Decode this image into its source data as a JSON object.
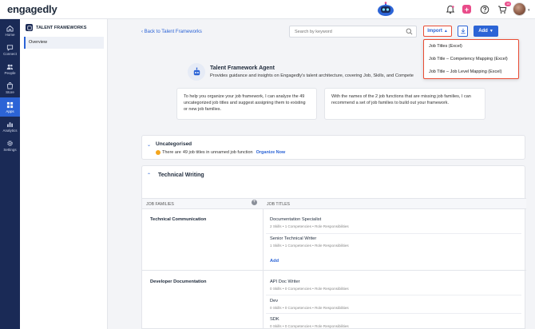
{
  "header": {
    "logo": "engagedly",
    "badge_count": "16",
    "add_label": "+",
    "icons": [
      "bell-icon",
      "plus-square-icon",
      "help-icon",
      "cart-icon"
    ]
  },
  "rail": {
    "items": [
      {
        "label": "Home",
        "icon": "home-icon"
      },
      {
        "label": "Connect",
        "icon": "chat-icon"
      },
      {
        "label": "People",
        "icon": "people-icon"
      },
      {
        "label": "Store",
        "icon": "store-icon"
      },
      {
        "label": "Apps",
        "icon": "apps-icon",
        "active": true
      },
      {
        "label": "Analytics",
        "icon": "analytics-icon"
      },
      {
        "label": "Settings",
        "icon": "settings-icon"
      }
    ]
  },
  "subnav": {
    "title": "TALENT FRAMEWORKS",
    "items": [
      "Overview"
    ]
  },
  "toolbar": {
    "back_label": "Back to Talent Frameworks",
    "search_placeholder": "Search by keyword",
    "import_label": "Import",
    "add_label": "Add"
  },
  "import_menu": {
    "options": [
      "Job Titles (Excel)",
      "Job Title – Competency Mapping (Excel)",
      "Job Title – Job Level Mapping (Excel)"
    ]
  },
  "agent": {
    "title": "Talent Framework Agent",
    "subtitle": "Provides guidance and insights on Engagedly's talent architecture, covering Job, Skills, and Compete",
    "cards": [
      "To help you organize your job framework, I can analyze the 49 uncategorized job titles and suggest assigning them to existing or new job families.",
      "With the names of the 2 job functions that are missing job families, I can recommend a set of job families to build out your framework."
    ]
  },
  "uncategorised": {
    "title": "Uncategorised",
    "prefix": "There are",
    "count_text": "49 job titles in unnamed job function",
    "action": "Organize Now"
  },
  "technical_writing": {
    "title": "Technical Writing",
    "col_families": "JOB FAMILIES",
    "col_titles": "JOB TITLES",
    "add_label": "Add",
    "families": [
      {
        "name": "Technical Communication",
        "jobs": [
          {
            "name": "Documentation Specialist",
            "meta": "2 Skills  •  1 Competencies  •  Role Responsibilities"
          },
          {
            "name": "Senior Technical Writer",
            "meta": "1 Skills  •  1 Competencies  •  Role Responsibilities"
          }
        ]
      },
      {
        "name": "Developer Documentation",
        "jobs": [
          {
            "name": "API Doc Writer",
            "meta": "0 Skills  •  0 Competencies  •  Role Responsibilities"
          },
          {
            "name": "Dev",
            "meta": "0 Skills  •  0 Competencies  •  Role Responsibilities"
          },
          {
            "name": "SDK",
            "meta": "0 Skills  •  0 Competencies  •  Role Responsibilities"
          }
        ]
      }
    ]
  },
  "colors": {
    "accent": "#2c64d6",
    "rail_bg": "#1a2a56",
    "highlight": "#e94c34",
    "pink": "#e94c8a"
  }
}
